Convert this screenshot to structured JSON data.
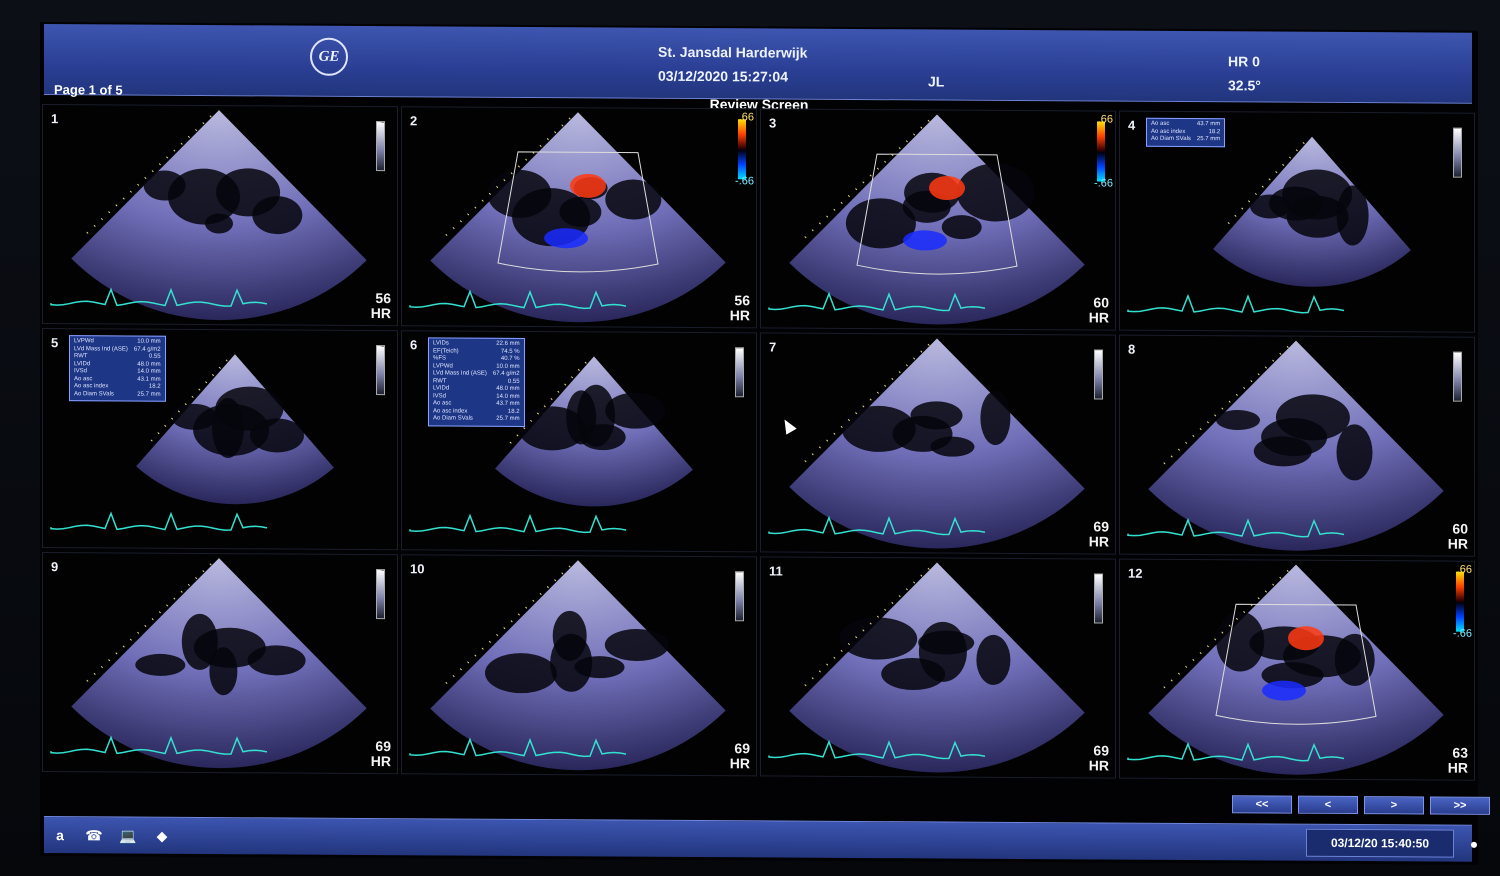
{
  "header": {
    "institution": "St. Jansdal Harderwijk",
    "datetime": "03/12/2020 15:27:04",
    "operator": "JL",
    "hr_label": "HR 0",
    "temp": "32.5°",
    "logo_text": "GE"
  },
  "page_label": "Page 1 of 5",
  "screen_title": "Review Screen",
  "tiles": [
    {
      "num": "1",
      "hr": "56",
      "hr_unit": "HR",
      "mode": "gray"
    },
    {
      "num": "2",
      "hr": "56",
      "hr_unit": "HR",
      "mode": "color",
      "scale_top": ".66",
      "scale_bot": "-.66"
    },
    {
      "num": "3",
      "hr": "60",
      "hr_unit": "HR",
      "mode": "color",
      "scale_top": ".66",
      "scale_bot": "-.66"
    },
    {
      "num": "4",
      "hr": "",
      "hr_unit": "",
      "mode": "gray",
      "measures": [
        [
          "Ao asc",
          "43.7 mm"
        ],
        [
          "Ao asc index",
          "18.2"
        ],
        [
          "Ao Diam SVals",
          "25.7 mm"
        ]
      ]
    },
    {
      "num": "5",
      "hr": "",
      "hr_unit": "",
      "mode": "gray",
      "measures": [
        [
          "LVPWd",
          "10.0 mm"
        ],
        [
          "LVd Mass Ind (ASE)",
          "67.4 g/m2"
        ],
        [
          "RWT",
          "0.55"
        ],
        [
          "LVIDd",
          "48.0 mm"
        ],
        [
          "IVSd",
          "14.0 mm"
        ],
        [
          "Ao asc",
          "43.1 mm"
        ],
        [
          "Ao asc index",
          "18.2"
        ],
        [
          "Ao Diam SVals",
          "25.7 mm"
        ]
      ]
    },
    {
      "num": "6",
      "hr": "",
      "hr_unit": "",
      "mode": "gray",
      "measures": [
        [
          "LVIDs",
          "22.6 mm"
        ],
        [
          "EF(Teich)",
          "74.5 %"
        ],
        [
          "%FS",
          "40.7 %"
        ],
        [
          "LVPWd",
          "10.0 mm"
        ],
        [
          "LVd Mass Ind (ASE)",
          "67.4 g/m2"
        ],
        [
          "RWT",
          "0.55"
        ],
        [
          "LVIDd",
          "48.0 mm"
        ],
        [
          "IVSd",
          "14.0 mm"
        ],
        [
          "Ao asc",
          "43.7 mm"
        ],
        [
          "Ao asc index",
          "18.2"
        ],
        [
          "Ao Diam SVals",
          "25.7 mm"
        ]
      ]
    },
    {
      "num": "7",
      "hr": "69",
      "hr_unit": "HR",
      "mode": "gray"
    },
    {
      "num": "8",
      "hr": "60",
      "hr_unit": "HR",
      "mode": "gray"
    },
    {
      "num": "9",
      "hr": "69",
      "hr_unit": "HR",
      "mode": "gray"
    },
    {
      "num": "10",
      "hr": "69",
      "hr_unit": "HR",
      "mode": "gray"
    },
    {
      "num": "11",
      "hr": "69",
      "hr_unit": "HR",
      "mode": "gray"
    },
    {
      "num": "12",
      "hr": "63",
      "hr_unit": "HR",
      "mode": "color",
      "scale_top": ".66",
      "scale_bot": "-.66"
    }
  ],
  "nav": {
    "first": "<<",
    "prev": "<",
    "next": ">",
    "last": ">>"
  },
  "taskbar": {
    "btn_a": "a",
    "clock": "03/12/20 15:40:50"
  },
  "colors": {
    "header_blue": "#2a3f94",
    "echo_tint": "#8a8ad8"
  }
}
